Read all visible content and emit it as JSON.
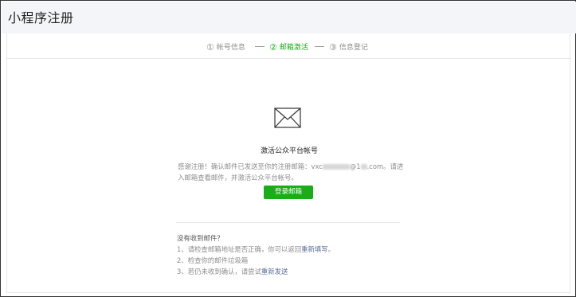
{
  "page": {
    "title": "小程序注册"
  },
  "steps": [
    {
      "num": "①",
      "label": "帐号信息",
      "active": false
    },
    {
      "num": "②",
      "label": "邮箱激活",
      "active": true
    },
    {
      "num": "③",
      "label": "信息登记",
      "active": false
    }
  ],
  "main": {
    "icon": "envelope-icon",
    "heading": "激活公众平台帐号",
    "desc_prefix": "感谢注册！确认邮件已发送至你的注册邮箱：",
    "email_start": "vxc",
    "email_mid": "@1",
    "email_end": ".com",
    "desc_suffix": "。请进入邮箱查看邮件，并激活公众平台帐号。",
    "login_button": "登录邮箱"
  },
  "help": {
    "question": "没有收到邮件？",
    "item1_prefix": "1、请检查邮箱地址是否正确，你可以返回",
    "item1_link": "重新填写",
    "item1_suffix": "。",
    "item2": "2、检查你的邮件垃圾箱",
    "item3_prefix": "3、若仍未收到确认，请尝试",
    "item3_link": "重新发送"
  },
  "colors": {
    "accent": "#1aad19",
    "link": "#576b95",
    "header_bg": "#f4f5f9"
  }
}
